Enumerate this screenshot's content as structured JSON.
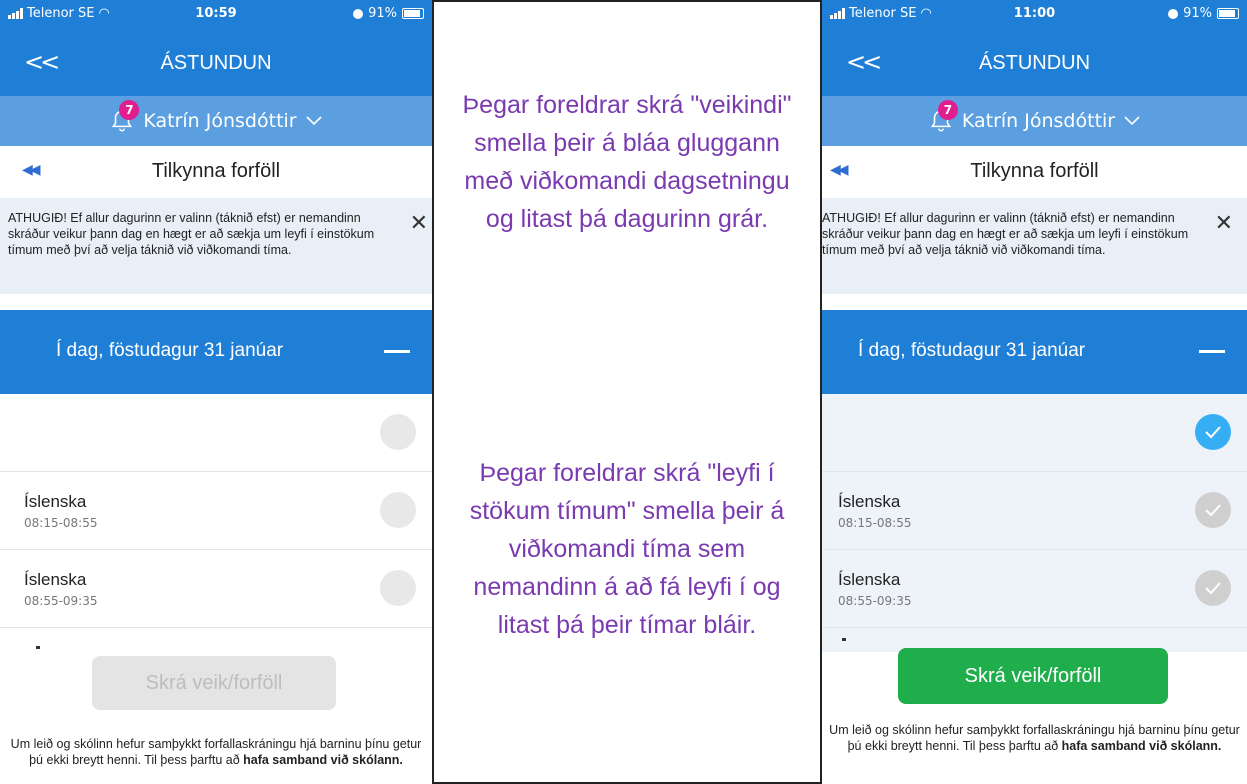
{
  "left": {
    "status": {
      "carrier": "Telenor SE",
      "time": "10:59",
      "battery": "91%"
    },
    "nav": {
      "back": "<<",
      "title": "ÁSTUNDUN"
    },
    "user": {
      "badge": "7",
      "name": "Katrín Jónsdóttir"
    },
    "header": {
      "first_icon": "skip-to-first-icon",
      "title": "Tilkynna forföll"
    },
    "notice": {
      "text": "ATHUGIÐ! Ef allur dagurinn er valinn (táknið efst) er nemandinn skráður veikur þann dag en hægt er að sækja um leyfi í einstökum tímum með því að velja táknið við viðkomandi tíma.",
      "close": "✕"
    },
    "day": {
      "label": "Í dag, föstudagur 31 janúar"
    },
    "rows": [
      {
        "name": "Íslenska",
        "time": "08:15-08:55"
      },
      {
        "name": "Íslenska",
        "time": "08:55-09:35"
      }
    ],
    "button": {
      "label": "Skrá veik/forföll"
    },
    "footer": {
      "text1": "Um leið og skólinn hefur samþykkt forfallaskráningu hjá barninu þínu getur þú ekki breytt henni. Til þess þarftu að ",
      "bold": "hafa samband við skólann."
    }
  },
  "right": {
    "status": {
      "carrier": "Telenor SE",
      "time": "11:00",
      "battery": "91%"
    },
    "nav": {
      "back": "<<",
      "title": "ÁSTUNDUN"
    },
    "user": {
      "badge": "7",
      "name": "Katrín Jónsdóttir"
    },
    "header": {
      "first_icon": "skip-to-first-icon",
      "title": "Tilkynna forföll"
    },
    "notice": {
      "text": "ATHUGIÐ! Ef allur dagurinn er valinn (táknið efst) er nemandinn skráður veikur þann dag en hægt er að sækja um leyfi í einstökum tímum með því að velja táknið við viðkomandi tíma.",
      "close": "✕"
    },
    "day": {
      "label": "Í dag, föstudagur 31 janúar"
    },
    "rows": [
      {
        "name": "Íslenska",
        "time": "08:15-08:55"
      },
      {
        "name": "Íslenska",
        "time": "08:55-09:35"
      }
    ],
    "button": {
      "label": "Skrá veik/forföll"
    },
    "footer": {
      "text1": "Um leið og skólinn hefur samþykkt forfallaskráningu hjá barninu þínu getur þú ekki breytt henni. Til þess þarftu að ",
      "bold": "hafa samband við skólann."
    }
  },
  "middle": {
    "text1": "Þegar foreldrar skrá \"veikindi\" smella þeir á bláa gluggann með viðkomandi dagsetningu og litast þá dagurinn grár.",
    "text2": "Þegar foreldrar skrá \"leyfi í stökum tímum\" smella þeir á viðkomandi tíma sem nemandinn á að fá leyfi í og litast þá þeir tímar bláir."
  },
  "colors": {
    "primary": "#1f7fd6",
    "userbar": "#5b9fe0",
    "accent_text": "#7a3ab0",
    "submit_enabled": "#1fae4b",
    "check_blue": "#36aef4"
  }
}
